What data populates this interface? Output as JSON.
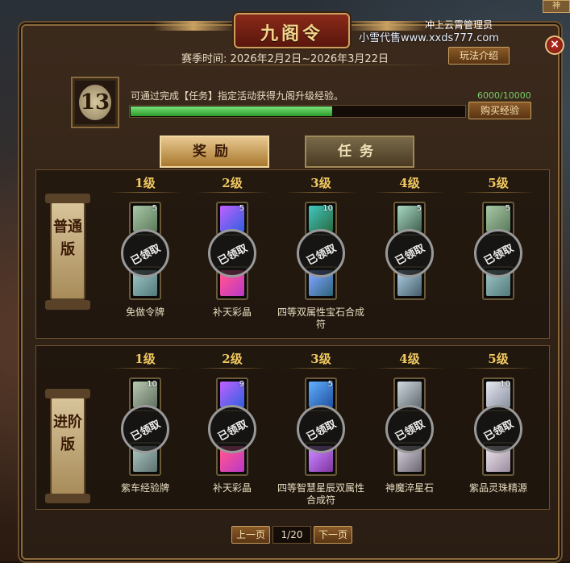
{
  "window": {
    "title": "九阁令",
    "close_label": "×",
    "top_right_tag": "神",
    "server_label": "冲上云霄管理员",
    "watermark": "小雪代售www.xxds777.com"
  },
  "season": {
    "text": "赛季时间: 2026年2月2日~2026年3月22日",
    "rules_button": "玩法介绍"
  },
  "exp": {
    "level": "13",
    "description": "可通过完成【任务】指定活动获得九阁升级经验。",
    "count": "6000/10000",
    "progress": 0.6,
    "buy_button": "购买经验"
  },
  "tabs": [
    {
      "label": "奖励",
      "active": true
    },
    {
      "label": "任务",
      "active": false
    }
  ],
  "claimed_label": "已领取",
  "tracks": [
    {
      "version": "普通版",
      "tiers": [
        {
          "level": "1级",
          "count": "5",
          "name": "免做令牌",
          "icon": "token-icon"
        },
        {
          "level": "2级",
          "count": "5",
          "name": "补天彩晶",
          "icon": "crystal-icon"
        },
        {
          "level": "3级",
          "count": "10",
          "name": "四等双属性宝石合成符",
          "icon": "gem-scroll-icon"
        },
        {
          "level": "4级",
          "count": "5",
          "name": "",
          "icon": "jade-token-icon"
        },
        {
          "level": "5级",
          "count": "5",
          "name": "",
          "icon": "token-icon"
        }
      ]
    },
    {
      "version": "进阶版",
      "tiers": [
        {
          "level": "1级",
          "count": "10",
          "name": "紫车经验牌",
          "icon": "exp-card-icon"
        },
        {
          "level": "2级",
          "count": "9",
          "name": "补天彩晶",
          "icon": "crystal-icon"
        },
        {
          "level": "3级",
          "count": "5",
          "name": "四等智慧星辰双属性合成符",
          "icon": "star-scroll-icon"
        },
        {
          "level": "4级",
          "count": "",
          "name": "神魔淬星石",
          "icon": "star-stone-icon"
        },
        {
          "level": "5级",
          "count": "10",
          "name": "紫品灵珠精源",
          "icon": "pearl-icon"
        }
      ]
    }
  ],
  "pager": {
    "prev": "上一页",
    "current": "1/20",
    "next": "下一页"
  },
  "colors": {
    "accent": "#c9a060",
    "claimed": "#999999",
    "progress": "#2a9a2a"
  }
}
